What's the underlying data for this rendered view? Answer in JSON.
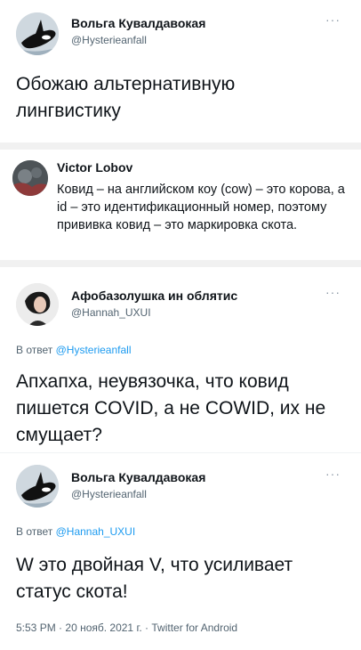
{
  "tweet1": {
    "display_name": "Вольга Кувалдавокая",
    "handle": "@Hysterieanfall",
    "more_icon": "ellipsis-icon",
    "text": "Обожаю альтернативную лингвистику"
  },
  "quoted": {
    "display_name": "Victor Lobov",
    "text": "Ковид – на английском коу (cow) – это корова, а id – это идентификационный номер, поэтому прививка ковид – это маркировка скота."
  },
  "tweet2": {
    "display_name": "Афобазолушка ин облятис",
    "handle": "@Hannah_UXUI",
    "more_icon": "ellipsis-icon",
    "reply_prefix": "В ответ",
    "reply_to": "@Hysterieanfall",
    "text": "Апхапха, неувязочка, что ковид пишется COVID, а не COWID, их не смущает?"
  },
  "tweet3": {
    "display_name": "Вольга Кувалдавокая",
    "handle": "@Hysterieanfall",
    "more_icon": "ellipsis-icon",
    "reply_prefix": "В ответ",
    "reply_to": "@Hannah_UXUI",
    "text": "W это двойная V, что усиливает статус скота!",
    "time": "5:53 PM",
    "dot1": "·",
    "date": "20 нояб. 2021 г.",
    "dot2": "·",
    "source": "Twitter for Android"
  }
}
